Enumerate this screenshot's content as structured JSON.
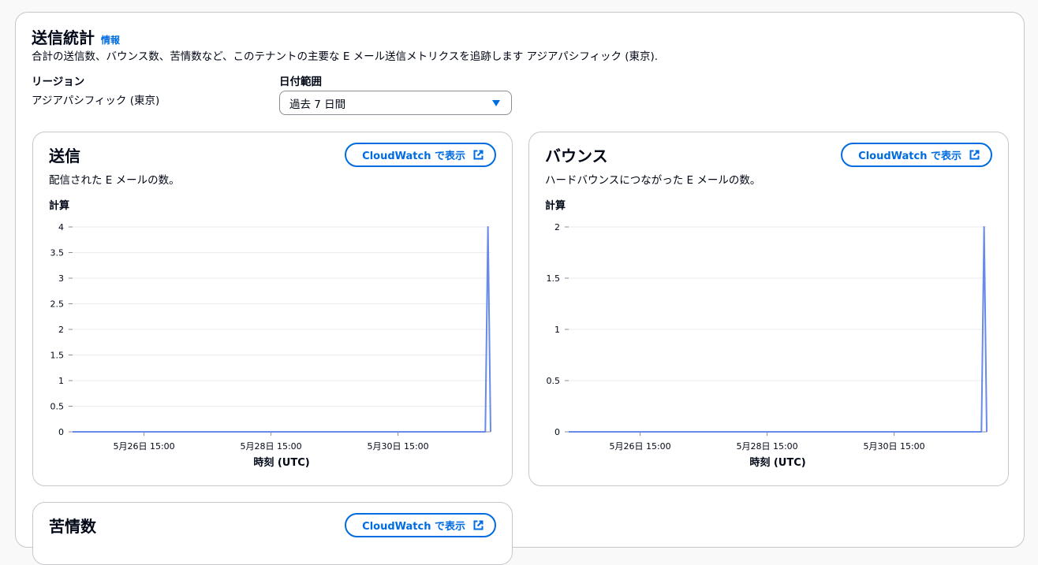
{
  "section": {
    "title": "送信統計",
    "info_link": "情報",
    "description": "合計の送信数、バウンス数、苦情数など、このテナントの主要な E メール送信メトリクスを追跡します アジアパシフィック (東京)."
  },
  "region": {
    "label": "リージョン",
    "value": "アジアパシフィック (東京)"
  },
  "date_range": {
    "label": "日付範囲",
    "selected": "過去 7 日間"
  },
  "cards": [
    {
      "title": "送信",
      "description": "配信された E メールの数。",
      "metric_label": "計算",
      "button_label": "CloudWatch で表示"
    },
    {
      "title": "バウンス",
      "description": "ハードバウンスにつながった E メールの数。",
      "metric_label": "計算",
      "button_label": "CloudWatch で表示"
    },
    {
      "title": "苦情数",
      "button_label": "CloudWatch で表示"
    }
  ],
  "colors": {
    "accent": "#006ce0",
    "series": "#688ae8",
    "grid": "#e9ebed",
    "border": "#c6c6cd"
  },
  "icons": {
    "external": "external-link-icon",
    "dropdown": "caret-down-icon"
  },
  "chart_data": [
    {
      "type": "line",
      "x": [
        "2025-05-25 12:00",
        "2025-06-01 00:00",
        "2025-06-01 01:00",
        "2025-06-01 02:00"
      ],
      "x_tick_labels": [
        "5月26日 15:00",
        "5月28日 15:00",
        "5月30日 15:00"
      ],
      "x_ticks": [
        "2025-05-26 15:00",
        "2025-05-28 15:00",
        "2025-05-30 15:00"
      ],
      "x_range": [
        "2025-05-25 12:00",
        "2025-06-01 02:00"
      ],
      "series": [
        {
          "values": [
            0,
            0,
            4,
            0
          ]
        }
      ],
      "xlabel": "時刻 (UTC)",
      "ylabel": "",
      "ylim": [
        0,
        4
      ],
      "y_ticks": [
        0,
        0.5,
        1,
        1.5,
        2,
        2.5,
        3,
        3.5,
        4
      ],
      "grid": true
    },
    {
      "type": "line",
      "x": [
        "2025-05-25 12:00",
        "2025-06-01 00:00",
        "2025-06-01 01:00",
        "2025-06-01 02:00"
      ],
      "x_tick_labels": [
        "5月26日 15:00",
        "5月28日 15:00",
        "5月30日 15:00"
      ],
      "x_ticks": [
        "2025-05-26 15:00",
        "2025-05-28 15:00",
        "2025-05-30 15:00"
      ],
      "x_range": [
        "2025-05-25 12:00",
        "2025-06-01 02:00"
      ],
      "series": [
        {
          "values": [
            0,
            0,
            2,
            0
          ]
        }
      ],
      "xlabel": "時刻 (UTC)",
      "ylabel": "",
      "ylim": [
        0,
        2
      ],
      "y_ticks": [
        0,
        0.5,
        1,
        1.5,
        2
      ],
      "grid": true
    }
  ]
}
